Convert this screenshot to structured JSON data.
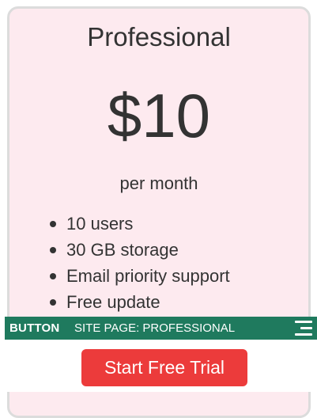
{
  "card": {
    "plan_name": "Professional",
    "price": "$10",
    "period": "per month",
    "background_color": "#fdeaef",
    "features": [
      "10 users",
      "30 GB storage",
      "Email priority support",
      "Free update"
    ]
  },
  "overlay": {
    "tag": "BUTTON",
    "site_page": "SITE PAGE: PROFESSIONAL",
    "bar_color": "#1f7a5e",
    "menu_icon": "hamburger-menu-icon"
  },
  "cta": {
    "label": "Start Free Trial",
    "color": "#ec3b3b"
  }
}
